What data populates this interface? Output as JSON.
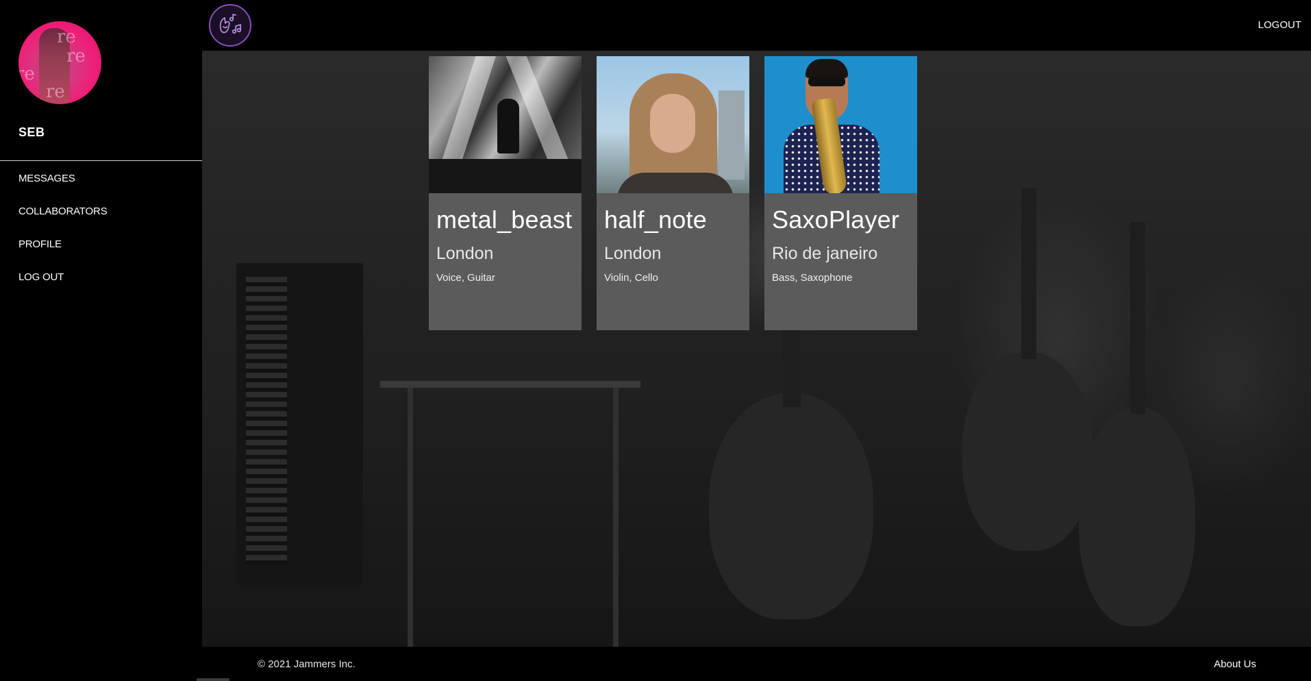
{
  "sidebar": {
    "username": "SEB",
    "avatar_text": "re",
    "nav": [
      {
        "label": "MESSAGES"
      },
      {
        "label": "COLLABORATORS"
      },
      {
        "label": "PROFILE"
      },
      {
        "label": "LOG OUT"
      }
    ]
  },
  "header": {
    "logo_icon": "music-hand-icon",
    "logout_label": "LOGOUT"
  },
  "cards": [
    {
      "name": "metal_beast",
      "city": "London",
      "instruments": "Voice, Guitar",
      "photo": "concert-stage-photo"
    },
    {
      "name": "half_note",
      "city": "London",
      "instruments": "Violin, Cello",
      "photo": "portrait-woman-photo"
    },
    {
      "name": "SaxoPlayer",
      "city": "Rio de janeiro",
      "instruments": "Bass, Saxophone",
      "photo": "saxophone-player-photo"
    }
  ],
  "footer": {
    "copyright": "© 2021 Jammers Inc.",
    "about_label": "About Us"
  },
  "colors": {
    "background": "#000000",
    "card_background": "#5b5b5b",
    "logo_ring": "#8a4fbf",
    "avatar_accent": "#ef1f78",
    "text": "#ffffff"
  }
}
